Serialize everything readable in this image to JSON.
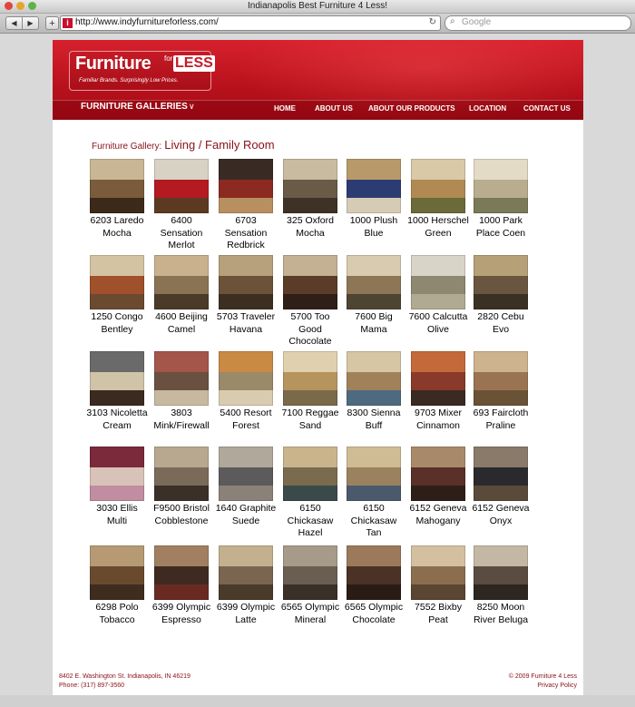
{
  "window": {
    "title": "Indianapolis Best Furniture 4 Less!"
  },
  "browser": {
    "url": "http://www.indyfurnitureforless.com/",
    "search_placeholder": "Google",
    "back_label": "◀",
    "forward_label": "▶",
    "add_label": "+",
    "reload_label": "↻"
  },
  "logo": {
    "main": "Furniture",
    "for": "for",
    "less": "LESS",
    "tagline": "Familiar Brands. Surprisingly Low Prices."
  },
  "nav": {
    "galleries": "FURNITURE GALLERIES",
    "chevron": "∨",
    "links": [
      "HOME",
      "ABOUT US",
      "ABOUT OUR PRODUCTS",
      "LOCATION",
      "CONTACT US"
    ]
  },
  "gallery": {
    "label": "Furniture Gallery:",
    "room": "Living / Family Room"
  },
  "products": [
    {
      "name": "6203 Laredo Mocha",
      "colors": [
        "#7a5b3c",
        "#c9b694",
        "#3b2a1a"
      ]
    },
    {
      "name": "6400 Sensation Merlot",
      "colors": [
        "#b31a22",
        "#d8d2c4",
        "#5c3a22"
      ]
    },
    {
      "name": "6703 Sensation Redbrick",
      "colors": [
        "#8c2a22",
        "#3a2a24",
        "#b88f60"
      ]
    },
    {
      "name": "325 Oxford Mocha",
      "colors": [
        "#6a5a48",
        "#c8bba0",
        "#3e3226"
      ]
    },
    {
      "name": "1000 Plush Blue",
      "colors": [
        "#2c3c72",
        "#b89a6a",
        "#d6cbb5"
      ]
    },
    {
      "name": "1000 Herschel Green",
      "colors": [
        "#b08a52",
        "#d9c9a6",
        "#6a6a3a"
      ]
    },
    {
      "name": "1000 Park Place Coen",
      "colors": [
        "#b9ad8f",
        "#e3dbc6",
        "#7a7a58"
      ]
    },
    {
      "name": "1250 Congo Bentley",
      "colors": [
        "#a0502a",
        "#d4c3a2",
        "#6b4a30"
      ]
    },
    {
      "name": "4600 Beijing Camel",
      "colors": [
        "#8a7352",
        "#c8b18c",
        "#4a3a28"
      ]
    },
    {
      "name": "5703 Traveler Havana",
      "colors": [
        "#6b5238",
        "#b7a17c",
        "#3c2f22"
      ]
    },
    {
      "name": "5700 Too Good Chocolate",
      "colors": [
        "#5a3c28",
        "#c4b092",
        "#2e2018"
      ]
    },
    {
      "name": "7600 Big Mama",
      "colors": [
        "#8c7656",
        "#d8cbb0",
        "#4e4432"
      ]
    },
    {
      "name": "7600 Calcutta Olive",
      "colors": [
        "#8e8870",
        "#d8d4c8",
        "#b0aa92"
      ]
    },
    {
      "name": "2820 Cebu Evo",
      "colors": [
        "#6a5640",
        "#b5a078",
        "#3a3024"
      ]
    },
    {
      "name": "3103 Nicoletta Cream",
      "colors": [
        "#cfc3a8",
        "#6a6a6a",
        "#3a2a20"
      ]
    },
    {
      "name": "3803 Mink/Firewall",
      "colors": [
        "#6a5040",
        "#a4564a",
        "#c7b9a0"
      ]
    },
    {
      "name": "5400 Resort Forest",
      "colors": [
        "#9a8a6a",
        "#c98a44",
        "#d8cbb0"
      ]
    },
    {
      "name": "7100 Reggae Sand",
      "colors": [
        "#b6945e",
        "#e0d0b0",
        "#7a6a4a"
      ]
    },
    {
      "name": "8300 Sienna Buff",
      "colors": [
        "#a0825a",
        "#d6c6a4",
        "#4e6a80"
      ]
    },
    {
      "name": "9703 Mixer Cinnamon",
      "colors": [
        "#8a3a2a",
        "#c46a3a",
        "#3a2a22"
      ]
    },
    {
      "name": "693 Faircloth Praline",
      "colors": [
        "#9a7452",
        "#cdb38e",
        "#6a5236"
      ]
    },
    {
      "name": "3030 Ellis Multi",
      "colors": [
        "#d9c2b8",
        "#7a2a3a",
        "#c08ea0"
      ]
    },
    {
      "name": "F9500 Bristol Cobblestone",
      "colors": [
        "#7a6a5a",
        "#b8a890",
        "#3a3028"
      ]
    },
    {
      "name": "1640 Graphite Suede",
      "colors": [
        "#5c5a5a",
        "#b0a89a",
        "#8a8278"
      ]
    },
    {
      "name": "6150 Chickasaw Hazel",
      "colors": [
        "#7a6a4e",
        "#c9b48c",
        "#3a4a4a"
      ]
    },
    {
      "name": "6150 Chickasaw Tan",
      "colors": [
        "#9a8260",
        "#cfbb94",
        "#4a5a6a"
      ]
    },
    {
      "name": "6152 Geneva Mahogany",
      "colors": [
        "#5a3028",
        "#a88a6a",
        "#2e1e18"
      ]
    },
    {
      "name": "6152 Geneva Onyx",
      "colors": [
        "#2a2a2e",
        "#8a7a6a",
        "#5a4a3a"
      ]
    },
    {
      "name": "6298 Polo Tobacco",
      "colors": [
        "#6a4a2e",
        "#b59a74",
        "#3e2c1e"
      ]
    },
    {
      "name": "6399 Olympic Espresso",
      "colors": [
        "#3e2a20",
        "#a08060",
        "#6a2a22"
      ]
    },
    {
      "name": "6399 Olympic Latte",
      "colors": [
        "#7a6650",
        "#c4b08e",
        "#4a3a2a"
      ]
    },
    {
      "name": "6565 Olympic Mineral",
      "colors": [
        "#6a5e52",
        "#a89a88",
        "#3a3028"
      ]
    },
    {
      "name": "6565 Olympic Chocolate",
      "colors": [
        "#4a3226",
        "#9a7a5a",
        "#2a1c14"
      ]
    },
    {
      "name": "7552 Bixby Peat",
      "colors": [
        "#8a6e4e",
        "#d4c0a0",
        "#5a4632"
      ]
    },
    {
      "name": "8250 Moon River Beluga",
      "colors": [
        "#5a4c40",
        "#c4b8a4",
        "#2e2620"
      ]
    }
  ],
  "footer": {
    "address": "8402 E. Washington St. Indianapolis, IN 46219",
    "phone": "Phone: (317) 897-3560",
    "copyright": "© 2009 Furniture 4 Less",
    "privacy": "Privacy Policy"
  }
}
